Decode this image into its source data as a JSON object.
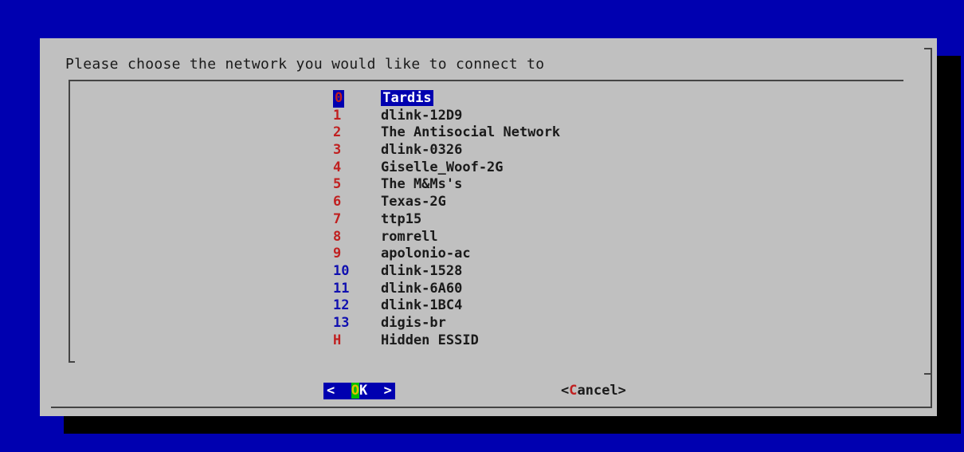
{
  "dialog": {
    "title": "Please choose the network you would like to connect to",
    "colors": {
      "screen_background": "#0000b0",
      "dialog_background": "#c0c0c0",
      "selection": "#0000b0",
      "tag_red": "#c02020",
      "tag_blue": "#1010b0"
    }
  },
  "networks": [
    {
      "tag": "0",
      "name": "Tardis",
      "selected": true,
      "tag_color": "red"
    },
    {
      "tag": "1",
      "name": "dlink-12D9",
      "selected": false,
      "tag_color": "red"
    },
    {
      "tag": "2",
      "name": "The Antisocial Network",
      "selected": false,
      "tag_color": "red"
    },
    {
      "tag": "3",
      "name": "dlink-0326",
      "selected": false,
      "tag_color": "red"
    },
    {
      "tag": "4",
      "name": "Giselle_Woof-2G",
      "selected": false,
      "tag_color": "red"
    },
    {
      "tag": "5",
      "name": "The M&Ms's",
      "selected": false,
      "tag_color": "red"
    },
    {
      "tag": "6",
      "name": "Texas-2G",
      "selected": false,
      "tag_color": "red"
    },
    {
      "tag": "7",
      "name": "ttp15",
      "selected": false,
      "tag_color": "red"
    },
    {
      "tag": "8",
      "name": "romrell",
      "selected": false,
      "tag_color": "red"
    },
    {
      "tag": "9",
      "name": "apolonio-ac",
      "selected": false,
      "tag_color": "red"
    },
    {
      "tag": "10",
      "name": "dlink-1528",
      "selected": false,
      "tag_color": "blue"
    },
    {
      "tag": "11",
      "name": "dlink-6A60",
      "selected": false,
      "tag_color": "blue"
    },
    {
      "tag": "12",
      "name": "dlink-1BC4",
      "selected": false,
      "tag_color": "blue"
    },
    {
      "tag": "13",
      "name": "digis-br",
      "selected": false,
      "tag_color": "blue"
    },
    {
      "tag": "H",
      "name": "Hidden ESSID",
      "selected": false,
      "tag_color": "red"
    }
  ],
  "buttons": {
    "ok": {
      "left": "<  ",
      "hot": "O",
      "rest": "K  >",
      "focused": true
    },
    "cancel": {
      "left": "<",
      "hot": "C",
      "rest": "ancel>",
      "focused": false
    }
  }
}
